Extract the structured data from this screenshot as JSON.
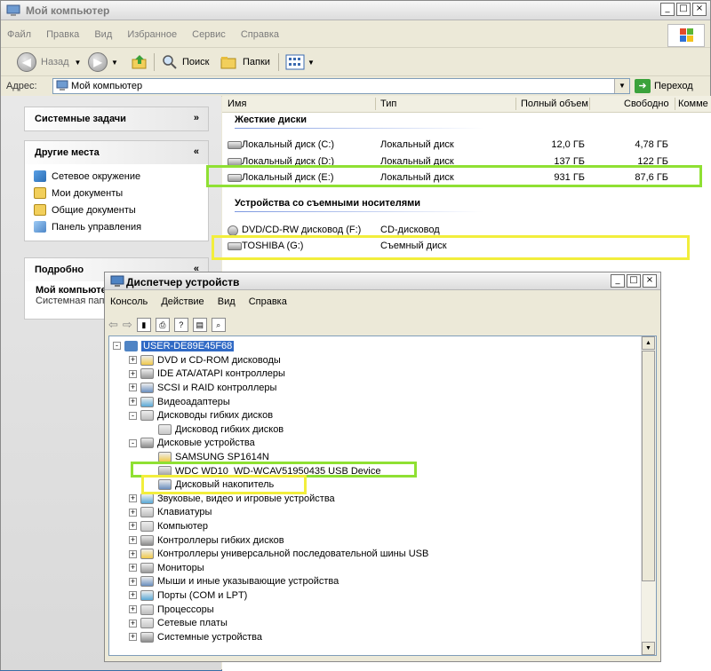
{
  "explorer": {
    "title": "Мой компьютер",
    "menu": [
      "Файл",
      "Правка",
      "Вид",
      "Избранное",
      "Сервис",
      "Справка"
    ],
    "toolbar": {
      "back": "Назад",
      "search": "Поиск",
      "folders": "Папки"
    },
    "address": {
      "label": "Адрес:",
      "value": "Мой компьютер",
      "go": "Переход"
    },
    "tasks": {
      "system_tasks": "Системные задачи",
      "other_places": {
        "title": "Другие места",
        "items": [
          {
            "label": "Сетевое окружение",
            "icon": "network-icon"
          },
          {
            "label": "Мои документы",
            "icon": "folder-icon"
          },
          {
            "label": "Общие документы",
            "icon": "folder-icon"
          },
          {
            "label": "Панель управления",
            "icon": "control-panel-icon"
          }
        ]
      },
      "details": {
        "title": "Подробно",
        "name": "Мой компьютер",
        "type": "Системная папка"
      }
    },
    "columns": [
      "Имя",
      "Тип",
      "Полный объем",
      "Свободно",
      "Комме"
    ],
    "groups": {
      "hard_disks": "Жесткие диски",
      "removable": "Устройства со съемными носителями"
    },
    "drives": [
      {
        "name": "Локальный диск (C:)",
        "type": "Локальный диск",
        "total": "12,0 ГБ",
        "free": "4,78 ГБ"
      },
      {
        "name": "Локальный диск (D:)",
        "type": "Локальный диск",
        "total": "137 ГБ",
        "free": "122 ГБ"
      },
      {
        "name": "Локальный диск (E:)",
        "type": "Локальный диск",
        "total": "931 ГБ",
        "free": "87,6 ГБ"
      }
    ],
    "removable": [
      {
        "name": "DVD/CD-RW дисковод (F:)",
        "type": "CD-дисковод"
      },
      {
        "name": "TOSHIBA (G:)",
        "type": "Съемный диск"
      }
    ]
  },
  "devmgr": {
    "title": "Диспетчер устройств",
    "menu": [
      "Консоль",
      "Действие",
      "Вид",
      "Справка"
    ],
    "root": "USER-DE89E45F68",
    "tree": [
      {
        "label": "DVD и CD-ROM дисководы",
        "level": 1,
        "toggle": "+"
      },
      {
        "label": "IDE ATA/ATAPI контроллеры",
        "level": 1,
        "toggle": "+"
      },
      {
        "label": "SCSI и RAID контроллеры",
        "level": 1,
        "toggle": "+"
      },
      {
        "label": "Видеоадаптеры",
        "level": 1,
        "toggle": "+"
      },
      {
        "label": "Дисководы гибких дисков",
        "level": 1,
        "toggle": "-"
      },
      {
        "label": "Дисковод гибких дисков",
        "level": 2,
        "toggle": ""
      },
      {
        "label": "Дисковые устройства",
        "level": 1,
        "toggle": "-"
      },
      {
        "label": "SAMSUNG SP1614N",
        "level": 2,
        "toggle": ""
      },
      {
        "label": "WDC WD10_WD-WCAV51950435 USB Device",
        "level": 2,
        "toggle": ""
      },
      {
        "label": "Дисковый накопитель",
        "level": 2,
        "toggle": ""
      },
      {
        "label": "Звуковые, видео и игровые устройства",
        "level": 1,
        "toggle": "+"
      },
      {
        "label": "Клавиатуры",
        "level": 1,
        "toggle": "+"
      },
      {
        "label": "Компьютер",
        "level": 1,
        "toggle": "+"
      },
      {
        "label": "Контроллеры гибких дисков",
        "level": 1,
        "toggle": "+"
      },
      {
        "label": "Контроллеры универсальной последовательной шины USB",
        "level": 1,
        "toggle": "+"
      },
      {
        "label": "Мониторы",
        "level": 1,
        "toggle": "+"
      },
      {
        "label": "Мыши и иные указывающие устройства",
        "level": 1,
        "toggle": "+"
      },
      {
        "label": "Порты (COM и LPT)",
        "level": 1,
        "toggle": "+"
      },
      {
        "label": "Процессоры",
        "level": 1,
        "toggle": "+"
      },
      {
        "label": "Сетевые платы",
        "level": 1,
        "toggle": "+"
      },
      {
        "label": "Системные устройства",
        "level": 1,
        "toggle": "+"
      }
    ]
  },
  "colors": {
    "highlight_green": "#8fe033",
    "highlight_yellow": "#f2ee3c",
    "selection": "#316ac5"
  }
}
